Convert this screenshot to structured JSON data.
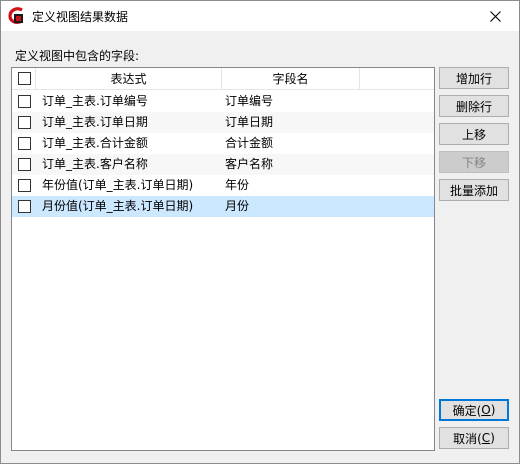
{
  "window": {
    "title": "定义视图结果数据",
    "close_glyph": "✕"
  },
  "section_label": "定义视图中包含的字段:",
  "table": {
    "headers": {
      "expression": "表达式",
      "field_name": "字段名"
    },
    "rows": [
      {
        "checked": false,
        "expression": "订单_主表.订单编号",
        "field_name": "订单编号",
        "selected": false
      },
      {
        "checked": false,
        "expression": "订单_主表.订单日期",
        "field_name": "订单日期",
        "selected": false
      },
      {
        "checked": false,
        "expression": "订单_主表.合计金额",
        "field_name": "合计金额",
        "selected": false
      },
      {
        "checked": false,
        "expression": "订单_主表.客户名称",
        "field_name": "客户名称",
        "selected": false
      },
      {
        "checked": false,
        "expression": "年份值(订单_主表.订单日期)",
        "field_name": "年份",
        "selected": false
      },
      {
        "checked": false,
        "expression": "月份值(订单_主表.订单日期)",
        "field_name": "月份",
        "selected": true
      }
    ]
  },
  "buttons": {
    "add_row": "增加行",
    "delete_row": "删除行",
    "move_up": "上移",
    "move_down": "下移",
    "batch_add": "批量添加",
    "ok_label": "确定(",
    "ok_key": "O",
    "ok_close": ")",
    "cancel_label": "取消(",
    "cancel_key": "C",
    "cancel_close": ")"
  },
  "colors": {
    "selected_row": "#cce8ff",
    "default_button_border": "#0078d7",
    "app_icon_red": "#d0121b"
  }
}
